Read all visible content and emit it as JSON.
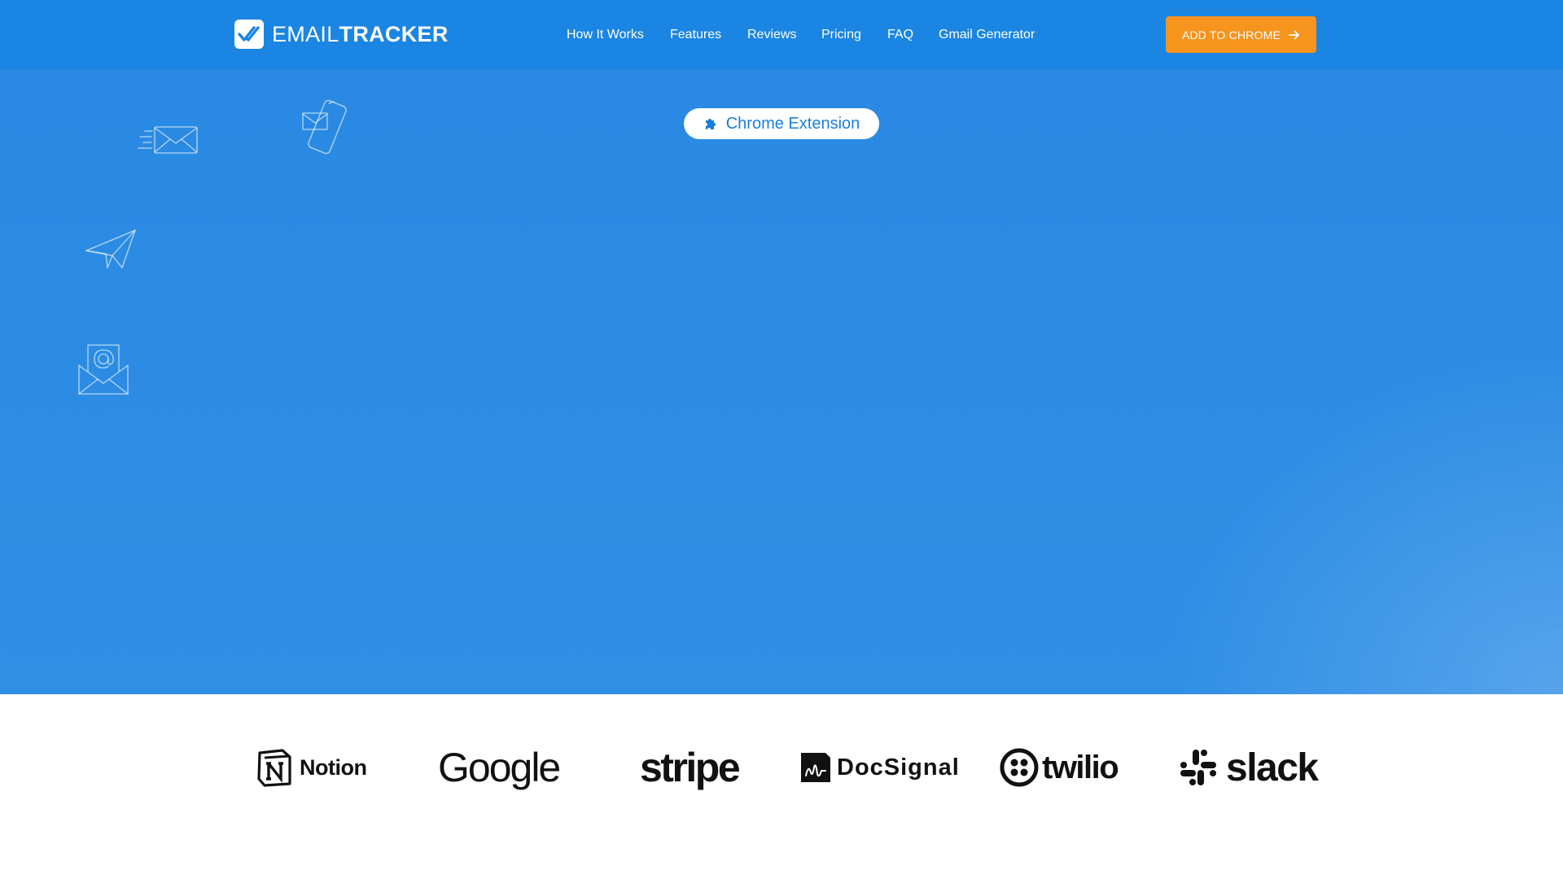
{
  "header": {
    "logo": {
      "light": "EMAIL",
      "bold": "TRACKER",
      "icon": "double-check-icon"
    },
    "nav": [
      {
        "label": "How It Works"
      },
      {
        "label": "Features"
      },
      {
        "label": "Reviews"
      },
      {
        "label": "Pricing"
      },
      {
        "label": "FAQ"
      },
      {
        "label": "Gmail Generator"
      }
    ],
    "cta": {
      "label": "ADD TO CHROME",
      "icon": "arrow-right-icon"
    }
  },
  "hero": {
    "badge": {
      "label": "Chrome Extension",
      "icon": "puzzle-icon"
    },
    "decorations": [
      "fast-mail-icon",
      "phone-mail-icon",
      "paper-plane-icon",
      "at-envelope-icon"
    ]
  },
  "brands": [
    {
      "name": "Notion"
    },
    {
      "name": "Google"
    },
    {
      "name": "stripe"
    },
    {
      "name": "DocSignal"
    },
    {
      "name": "twilio"
    },
    {
      "name": "slack"
    }
  ],
  "colors": {
    "header_bg": "#1a85e2",
    "hero_bg": "#2d8de4",
    "cta_bg": "#f7941d",
    "badge_text": "#1a7fd8"
  }
}
